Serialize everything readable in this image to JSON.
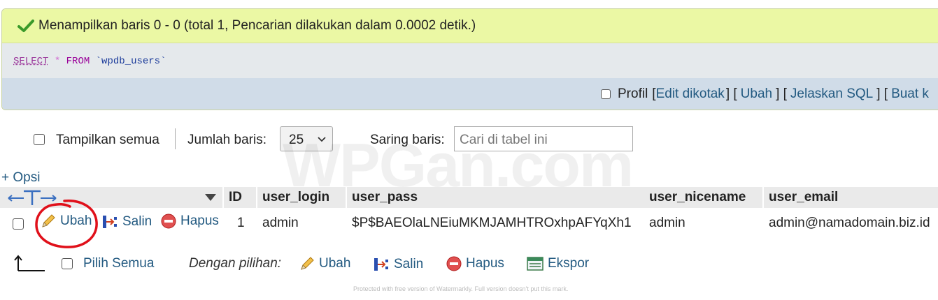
{
  "result": {
    "message": "Menampilkan baris 0 - 0 (total 1, Pencarian dilakukan dalam 0.0002 detik.)",
    "sql": {
      "select": "SELECT",
      "star": "*",
      "from": "FROM",
      "table": "`wpdb_users`"
    },
    "actions": {
      "profil": "Profil",
      "open_bracket": "[",
      "edit_inline": "Edit dikotak",
      "sep1": "] [",
      "edit": "Ubah",
      "sep2": "] [",
      "explain": "Jelaskan SQL",
      "sep3": "] [",
      "create": "Buat k"
    }
  },
  "nav": {
    "show_all": "Tampilkan semua",
    "rows_label": "Jumlah baris:",
    "rows_value": "25",
    "filter_label": "Saring baris:",
    "filter_placeholder": "Cari di tabel ini"
  },
  "watermark": "WPGan.com",
  "options_link": "+ Opsi",
  "table": {
    "columns": [
      "ID",
      "user_login",
      "user_pass",
      "user_nicename",
      "user_email"
    ],
    "rows": [
      {
        "edit": "Ubah",
        "copy": "Salin",
        "delete": "Hapus",
        "cells": [
          "1",
          "admin",
          "$P$BAEOlaLNEiuMKMJAMHTROxhpAFYqXh1",
          "admin",
          "admin@namadomain.biz.id"
        ]
      }
    ]
  },
  "bulk": {
    "select_all": "Pilih Semua",
    "with_selected": "Dengan pilihan:",
    "edit": "Ubah",
    "copy": "Salin",
    "delete": "Hapus",
    "export": "Ekspor"
  },
  "footer_note": "Protected with free version of Watermarkly. Full version doesn't put this mark.",
  "colors": {
    "success_bg": "#ebf8a4",
    "link": "#235a81",
    "header_bg": "#eaeaea",
    "annotation": "#e0101a"
  },
  "icons": [
    "check-icon",
    "pencil-icon",
    "copy-icon",
    "delete-icon",
    "export-icon",
    "chevron-down-icon",
    "sort-arrows-icon",
    "select-all-arrow-icon"
  ]
}
